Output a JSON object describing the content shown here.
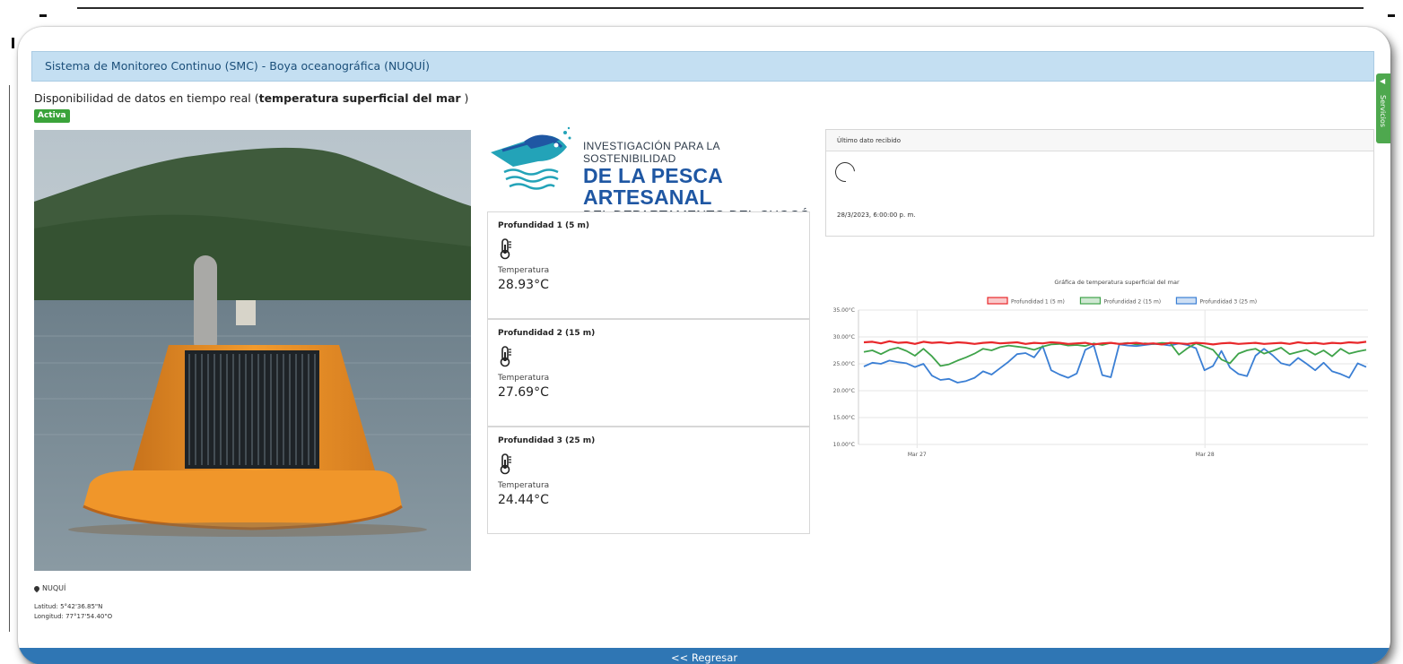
{
  "header": {
    "title": "Sistema de Monitoreo Continuo (SMC) - Boya oceanográfica (NUQUÍ)"
  },
  "subtitle": {
    "prefix": "Disponibilidad de datos en tiempo real (",
    "bold": "temperatura superficial del mar",
    "suffix": " )"
  },
  "status_badge": "Activa",
  "side_tab": {
    "label": "Servicios",
    "icon": "chevron-left-icon"
  },
  "location": {
    "name": "NUQUÍ",
    "latitude": "Latitud: 5°42'36.85\"N",
    "longitude": "Longitud: 77°17'54.40\"O"
  },
  "logo": {
    "line1": "INVESTIGACIÓN PARA LA SOSTENIBILIDAD",
    "line2": "DE LA PESCA ARTESANAL",
    "line3": "DEL DEPARTAMENTO DEL CHOCÓ"
  },
  "depths": [
    {
      "title": "Profundidad 1 (5 m)",
      "label": "Temperatura",
      "value": "28.93°C"
    },
    {
      "title": "Profundidad 2 (15 m)",
      "label": "Temperatura",
      "value": "27.69°C"
    },
    {
      "title": "Profundidad 3 (25 m)",
      "label": "Temperatura",
      "value": "24.44°C"
    }
  ],
  "last_data": {
    "header": "Último dato recibido",
    "timestamp": "28/3/2023, 6:00:00 p. m."
  },
  "chart_data": {
    "type": "line",
    "title": "Gráfica de temperatura superficial del mar",
    "legend_position": "top",
    "y_ticks": [
      "35.00°C",
      "30.00°C",
      "25.00°C",
      "20.00°C",
      "15.00°C",
      "10.00°C"
    ],
    "ylim": [
      10,
      35
    ],
    "x_ticks": [
      "Mar 27",
      "Mar 28"
    ],
    "grid": true,
    "series": [
      {
        "name": "Profundidad 1 (5 m)",
        "color": "#e8282b",
        "values": [
          29.0,
          29.1,
          28.8,
          29.2,
          28.9,
          29.0,
          28.7,
          29.1,
          28.9,
          29.0,
          28.8,
          29.0,
          28.9,
          28.7,
          28.9,
          29.0,
          28.8,
          28.9,
          29.0,
          28.7,
          28.9,
          28.8,
          29.0,
          28.9,
          28.7,
          28.8,
          28.9,
          28.6,
          28.8,
          28.9,
          28.7,
          28.8,
          28.9,
          28.7,
          28.8,
          28.6,
          28.9,
          28.8,
          28.7,
          28.9,
          28.8,
          28.6,
          28.8,
          28.9,
          28.7,
          28.8,
          28.9,
          28.7,
          28.8,
          28.9,
          28.7,
          29.0,
          28.8,
          28.9,
          28.7,
          28.9,
          28.8,
          29.0,
          28.9,
          29.1
        ]
      },
      {
        "name": "Profundidad 2 (15 m)",
        "color": "#3fa34a",
        "values": [
          27.2,
          27.5,
          26.8,
          27.6,
          28.0,
          27.4,
          26.5,
          27.8,
          26.4,
          24.6,
          24.9,
          25.6,
          26.2,
          26.9,
          27.8,
          27.5,
          28.1,
          28.4,
          28.2,
          28.0,
          27.6,
          28.2,
          28.6,
          28.7,
          28.4,
          28.5,
          28.3,
          28.8,
          28.5,
          28.9,
          28.7,
          28.9,
          28.6,
          28.8,
          28.7,
          28.9,
          28.8,
          26.7,
          27.9,
          28.8,
          28.2,
          27.6,
          25.8,
          25.1,
          26.9,
          27.5,
          27.8,
          26.9,
          27.4,
          28.0,
          26.8,
          27.2,
          27.6,
          26.7,
          27.5,
          26.4,
          27.8,
          26.9,
          27.3,
          27.6
        ]
      },
      {
        "name": "Profundidad 3 (25 m)",
        "color": "#3b7fd4",
        "values": [
          24.5,
          25.2,
          25.0,
          25.6,
          25.3,
          25.1,
          24.4,
          25.0,
          22.8,
          22.0,
          22.2,
          21.5,
          21.8,
          22.4,
          23.6,
          23.0,
          24.2,
          25.4,
          26.8,
          27.0,
          26.2,
          28.3,
          23.8,
          23.0,
          22.4,
          23.2,
          27.6,
          28.4,
          22.9,
          22.5,
          28.6,
          28.4,
          28.3,
          28.5,
          28.7,
          28.6,
          28.4,
          28.8,
          28.5,
          27.9,
          23.8,
          24.6,
          27.4,
          24.3,
          23.1,
          22.7,
          26.5,
          27.8,
          26.6,
          25.1,
          24.7,
          26.1,
          25.0,
          23.8,
          25.2,
          23.6,
          23.1,
          22.4,
          25.1,
          24.4
        ]
      }
    ]
  },
  "footer": {
    "back_label": "<< Regresar"
  }
}
